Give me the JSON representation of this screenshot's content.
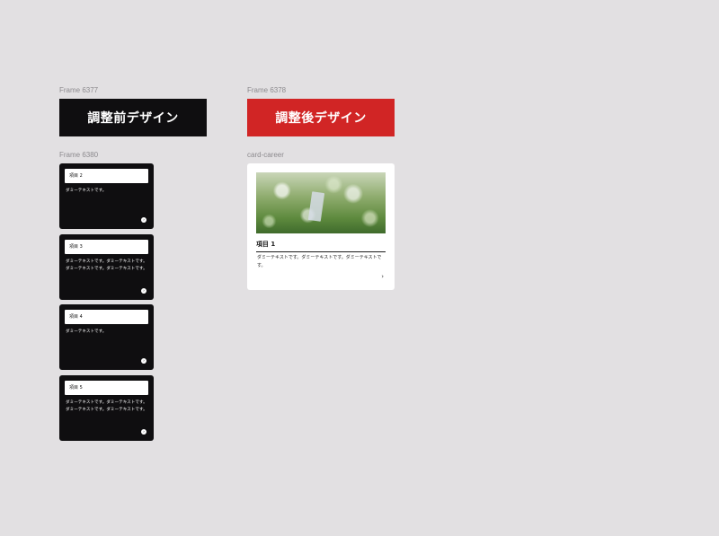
{
  "frames": {
    "before_label": "Frame 6377",
    "after_label": "Frame 6378",
    "list_label": "Frame 6380",
    "card_label": "card-career"
  },
  "banners": {
    "before": "調整前デザイン",
    "after": "調整後デザイン"
  },
  "dark_cards": [
    {
      "heading": "項目 2",
      "body": "ダミーテキストです。"
    },
    {
      "heading": "項目 3",
      "body": "ダミーテキストです。ダミーテキストです。ダミーテキストです。ダミーテキストです。"
    },
    {
      "heading": "項目 4",
      "body": "ダミーテキストです。"
    },
    {
      "heading": "項目 5",
      "body": "ダミーテキストです。ダミーテキストです。ダミーテキストです。ダミーテキストです。"
    }
  ],
  "career_card": {
    "title": "項目 1",
    "body": "ダミーテキストです。ダミーテキストです。ダミーテキストです。",
    "chevron": "›"
  },
  "colors": {
    "background": "#e2e0e2",
    "dark": "#0f0e10",
    "accent": "#d12525"
  },
  "icons": {
    "arrow": "arrow-right-circle-icon",
    "chevron": "chevron-right-icon"
  }
}
